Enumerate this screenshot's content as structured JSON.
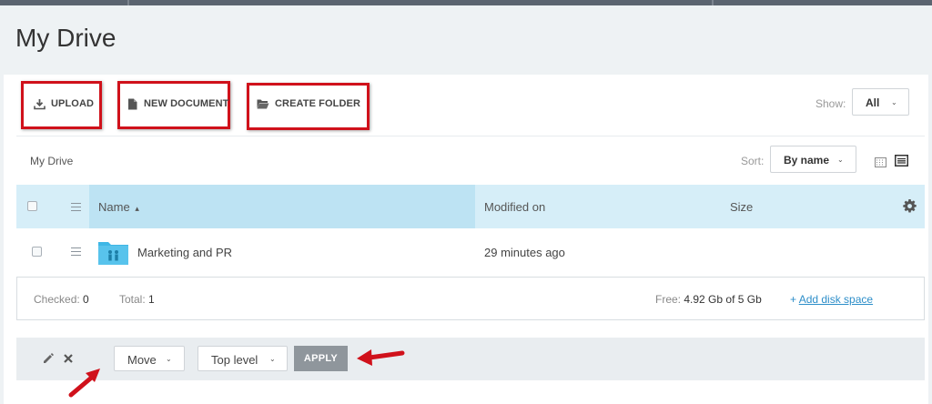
{
  "page": {
    "title": "My Drive"
  },
  "toolbar": {
    "upload_label": "UPLOAD",
    "new_document_label": "NEW DOCUMENT",
    "create_folder_label": "CREATE FOLDER",
    "show_label": "Show:",
    "show_value": "All"
  },
  "nav": {
    "breadcrumb": "My Drive",
    "sort_label": "Sort:",
    "sort_value": "By name"
  },
  "table": {
    "columns": [
      "Name",
      "Modified on",
      "Size"
    ],
    "name_sort_indicator": "▴",
    "rows": [
      {
        "name": "Marketing and PR",
        "modified": "29 minutes ago",
        "size": ""
      }
    ]
  },
  "footer": {
    "checked_label": "Checked:",
    "checked_value": "0",
    "total_label": "Total:",
    "total_value": "1",
    "free_label": "Free:",
    "free_value": "4.92 Gb of 5 Gb",
    "add_disk_prefix": "+ ",
    "add_disk_label": "Add disk space"
  },
  "actions": {
    "move_value": "Move",
    "level_value": "Top level",
    "apply_label": "APPLY"
  },
  "icons": {
    "upload": "download-tray-icon",
    "document": "document-icon",
    "folder": "open-folder-icon",
    "settings": "gear-icon",
    "edit": "pencil-icon",
    "delete": "close-icon",
    "view_grid": "grid-view-icon",
    "view_list": "list-view-icon"
  },
  "colors": {
    "highlight": "#d0111b",
    "header_bg": "#d6eef8",
    "name_header_bg": "#bde3f3",
    "folder": "#3fb7e6",
    "link": "#2d8ec9",
    "apply_bg": "#8f969c"
  }
}
